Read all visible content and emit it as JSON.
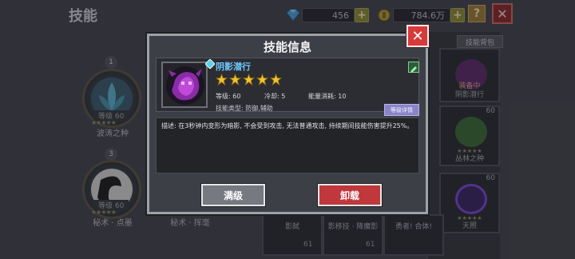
{
  "header": {
    "title": "技能",
    "diamonds": "456",
    "gold": "784.6万",
    "help": "?",
    "close": "✕"
  },
  "left_slots": [
    {
      "num": "1",
      "level": "等级 60",
      "name": "波涛之种"
    },
    {
      "num": "3",
      "level": "等级 60",
      "name": "秘术 · 点墨"
    }
  ],
  "left_bottom_labels": [
    "秘术 · 挥毫"
  ],
  "right_panel": {
    "bag_tab": "技能背包",
    "cards": [
      {
        "level": "",
        "name": "阴影潜行",
        "status": "装备中"
      },
      {
        "level": "60",
        "name": "丛林之种"
      },
      {
        "level": "60",
        "name": "天照"
      }
    ]
  },
  "mid_cards": [
    "影弑",
    "影移技 · 降魔影",
    "勇者! 合体!"
  ],
  "bottom_levels": [
    "61",
    "61"
  ],
  "modal": {
    "title": "技能信息",
    "close": "✕",
    "skill_name": "阴影潜行",
    "star_count": 5,
    "level_label": "等级: 60",
    "cooldown_label": "冷却: 5",
    "energy_label": "能量消耗: 10",
    "type_label": "技能类型: 防御,辅助",
    "detail_button": "等级详情",
    "description": "描述: 在3秒钟内变形为暗影, 不会受到攻击, 无法普通攻击, 持续期间技能伤害提升25%。",
    "max_button": "满级",
    "unload_button": "卸载"
  },
  "colors": {
    "skill_name": "#6ec8ff",
    "unload": "#c0383b",
    "star": "#f2c530"
  }
}
